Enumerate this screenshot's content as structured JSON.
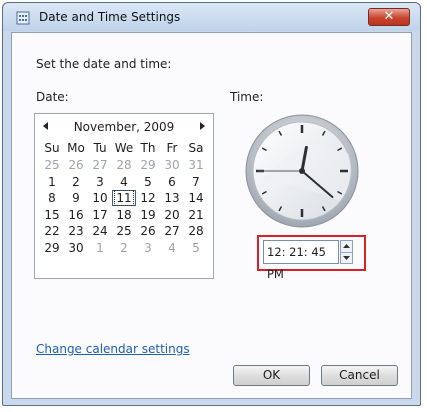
{
  "window": {
    "title": "Date and Time Settings",
    "close_glyph": "✕"
  },
  "instruction": "Set the date and time:",
  "date_label": "Date:",
  "time_label": "Time:",
  "calendar": {
    "month_year": "November, 2009",
    "weekdays": [
      "Su",
      "Mo",
      "Tu",
      "We",
      "Th",
      "Fr",
      "Sa"
    ],
    "weeks": [
      [
        {
          "d": "25",
          "m": true
        },
        {
          "d": "26",
          "m": true
        },
        {
          "d": "27",
          "m": true
        },
        {
          "d": "28",
          "m": true
        },
        {
          "d": "29",
          "m": true
        },
        {
          "d": "30",
          "m": true
        },
        {
          "d": "31",
          "m": true
        }
      ],
      [
        {
          "d": "1"
        },
        {
          "d": "2"
        },
        {
          "d": "3"
        },
        {
          "d": "4"
        },
        {
          "d": "5"
        },
        {
          "d": "6"
        },
        {
          "d": "7"
        }
      ],
      [
        {
          "d": "8"
        },
        {
          "d": "9"
        },
        {
          "d": "10"
        },
        {
          "d": "11",
          "sel": true
        },
        {
          "d": "12"
        },
        {
          "d": "13"
        },
        {
          "d": "14"
        }
      ],
      [
        {
          "d": "15"
        },
        {
          "d": "16"
        },
        {
          "d": "17"
        },
        {
          "d": "18"
        },
        {
          "d": "19"
        },
        {
          "d": "20"
        },
        {
          "d": "21"
        }
      ],
      [
        {
          "d": "22"
        },
        {
          "d": "23"
        },
        {
          "d": "24"
        },
        {
          "d": "25"
        },
        {
          "d": "26"
        },
        {
          "d": "27"
        },
        {
          "d": "28"
        }
      ],
      [
        {
          "d": "29"
        },
        {
          "d": "30"
        },
        {
          "d": "1",
          "m": true
        },
        {
          "d": "2",
          "m": true
        },
        {
          "d": "3",
          "m": true
        },
        {
          "d": "4",
          "m": true
        },
        {
          "d": "5",
          "m": true
        }
      ]
    ]
  },
  "clock": {
    "hour": 12,
    "minute": 21,
    "second": 45
  },
  "time_value": "12: 21: 45 PM",
  "change_calendar_link": "Change calendar settings",
  "buttons": {
    "ok": "OK",
    "cancel": "Cancel"
  },
  "colors": {
    "highlight": "#d6202a",
    "link": "#1c5fb4"
  }
}
